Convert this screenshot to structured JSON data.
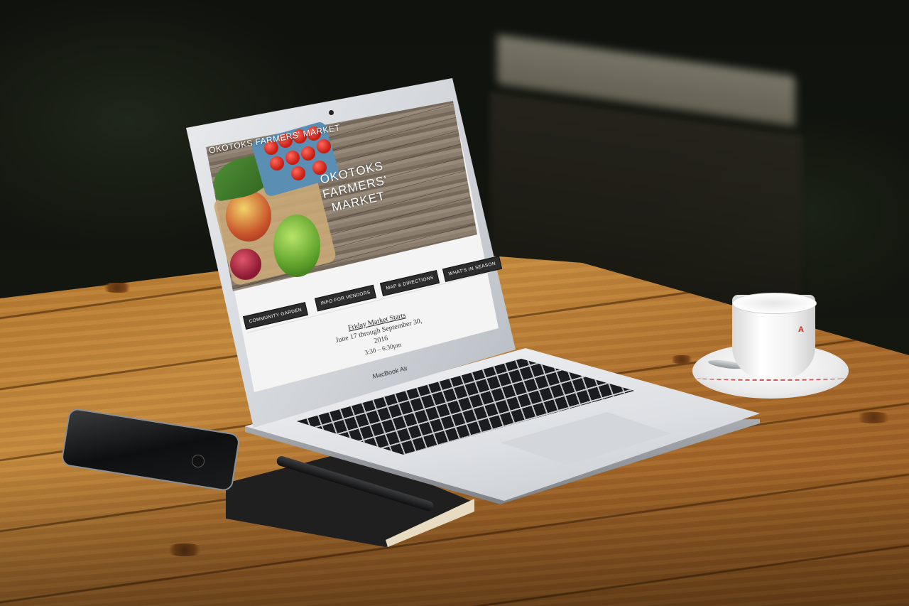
{
  "site": {
    "nav_title": "OKOTOKS FARMERS' MARKET",
    "hero_title_lines": [
      "OKOTOKS",
      "FARMERS'",
      "MARKET"
    ]
  },
  "nav_buttons": [
    {
      "label": "COMMUNITY GARDEN"
    },
    {
      "label": "INFO FOR VENDORS"
    },
    {
      "label": "MAP & DIRECTIONS"
    },
    {
      "label": "WHAT'S IN SEASON"
    }
  ],
  "event": {
    "title": "Friday Market Starts",
    "dates": "June 17 through September 30, 2016",
    "hours": "3:30 – 6:30pm"
  },
  "device": {
    "laptop_label": "MacBook Air"
  },
  "colors": {
    "button_bg": "#2c2c2c",
    "page_bg": "#f4f4f4",
    "table_wood": "#b5782f"
  }
}
